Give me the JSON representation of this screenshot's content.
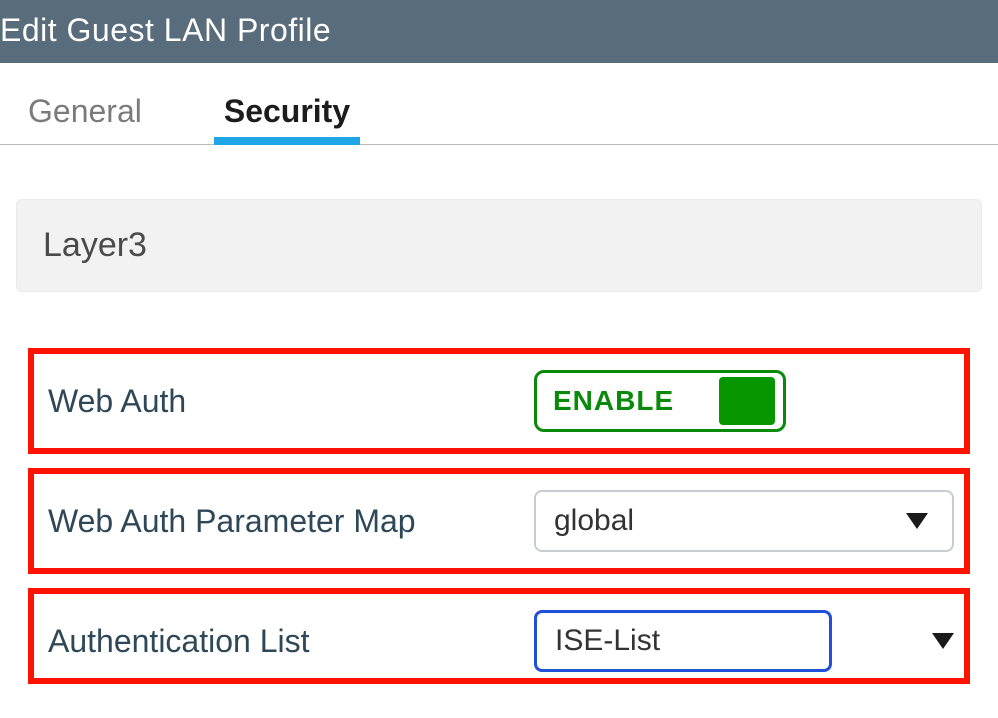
{
  "header": {
    "title": "Edit Guest LAN Profile"
  },
  "tabs": {
    "general": "General",
    "security": "Security",
    "active": "security"
  },
  "section": {
    "layer3": "Layer3"
  },
  "fields": {
    "webAuth": {
      "label": "Web Auth",
      "toggleState": "ENABLE"
    },
    "paramMap": {
      "label": "Web Auth Parameter Map",
      "value": "global"
    },
    "authList": {
      "label": "Authentication List",
      "value": "ISE-List"
    }
  }
}
